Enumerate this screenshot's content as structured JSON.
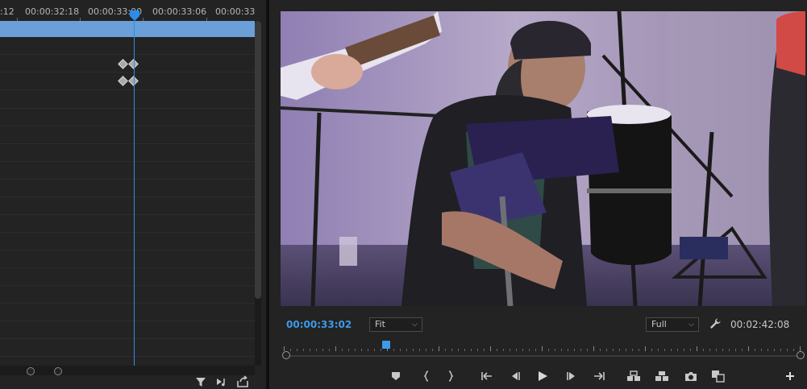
{
  "effect_controls": {
    "ruler_labels": [
      ":12",
      "00:00:32:18",
      "00:00:33:00",
      "00:00:33:06",
      "00:00:33"
    ],
    "keyframe_rows": 2
  },
  "program_monitor": {
    "current_timecode": "00:00:33:02",
    "zoom_select": "Fit",
    "resolution_select": "Full",
    "duration_timecode": "00:02:42:08"
  },
  "icons": {
    "filter": "filter-icon",
    "play_only_audio": "audio-only-icon",
    "export": "export-icon",
    "marker": "add-marker-icon",
    "mark_in": "mark-in-icon",
    "mark_out": "mark-out-icon",
    "go_to_in": "go-to-in-icon",
    "step_back": "step-back-icon",
    "play": "play-icon",
    "step_forward": "step-forward-icon",
    "go_to_out": "go-to-out-icon",
    "lift": "lift-icon",
    "extract": "extract-icon",
    "export_frame": "camera-icon",
    "compare": "comparison-view-icon",
    "add": "plus-icon",
    "settings": "wrench-icon"
  },
  "colors": {
    "accent": "#3d9ae8",
    "work_area": "#6a9fd8",
    "panel_bg": "#232323"
  }
}
